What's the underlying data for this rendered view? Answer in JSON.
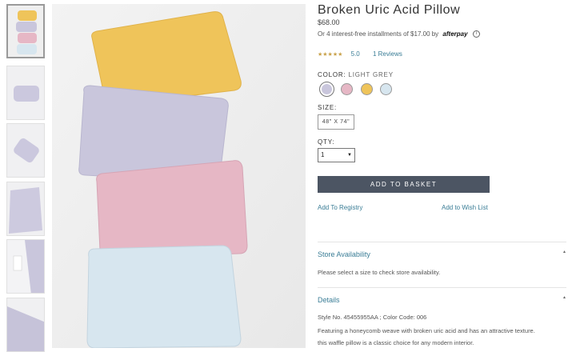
{
  "product": {
    "title": "Broken Uric Acid Pillow",
    "price": "$68.00",
    "installments": "Or 4 interest-free installments of $17.00 by",
    "afterpay_logo": "afterpay",
    "info_icon": "info-circle-icon",
    "rating_stars": "★★★★★",
    "rating_value": "5.0",
    "reviews": "1 Reviews"
  },
  "color": {
    "label": "COLOR:",
    "selected": "LIGHT GREY",
    "swatches": [
      {
        "name": "lavender grey",
        "hex": "#c9c6dc"
      },
      {
        "name": "pink",
        "hex": "#e6b7c5"
      },
      {
        "name": "yellow",
        "hex": "#efc45a"
      },
      {
        "name": "light blue",
        "hex": "#d7e6ef"
      }
    ]
  },
  "size": {
    "label": "SIZE:",
    "value": "48\" X 74\""
  },
  "qty": {
    "label": "QTY:",
    "value": "1"
  },
  "actions": {
    "add_to_basket": "ADD TO BASKET",
    "add_to_registry": "Add To Registry",
    "add_to_wishlist": "Add to Wish List"
  },
  "store_availability": {
    "title": "Store Availability",
    "text": "Please select a size to check store availability."
  },
  "details": {
    "title": "Details",
    "style_line": "Style No. 45455955AA ; Color Code: 006",
    "desc_1": "Featuring a honeycomb weave with broken uric acid and has an attractive texture.",
    "desc_2": "this waffle pillow is a  classic choice for any modern interior."
  },
  "colors": {
    "link": "#3a7d96",
    "button": "#4c5563",
    "yellow_pillow": "#efc45a",
    "lavender_pillow": "#c9c6dc",
    "pink_pillow": "#e6b7c5",
    "blue_pillow": "#d7e6ef"
  }
}
